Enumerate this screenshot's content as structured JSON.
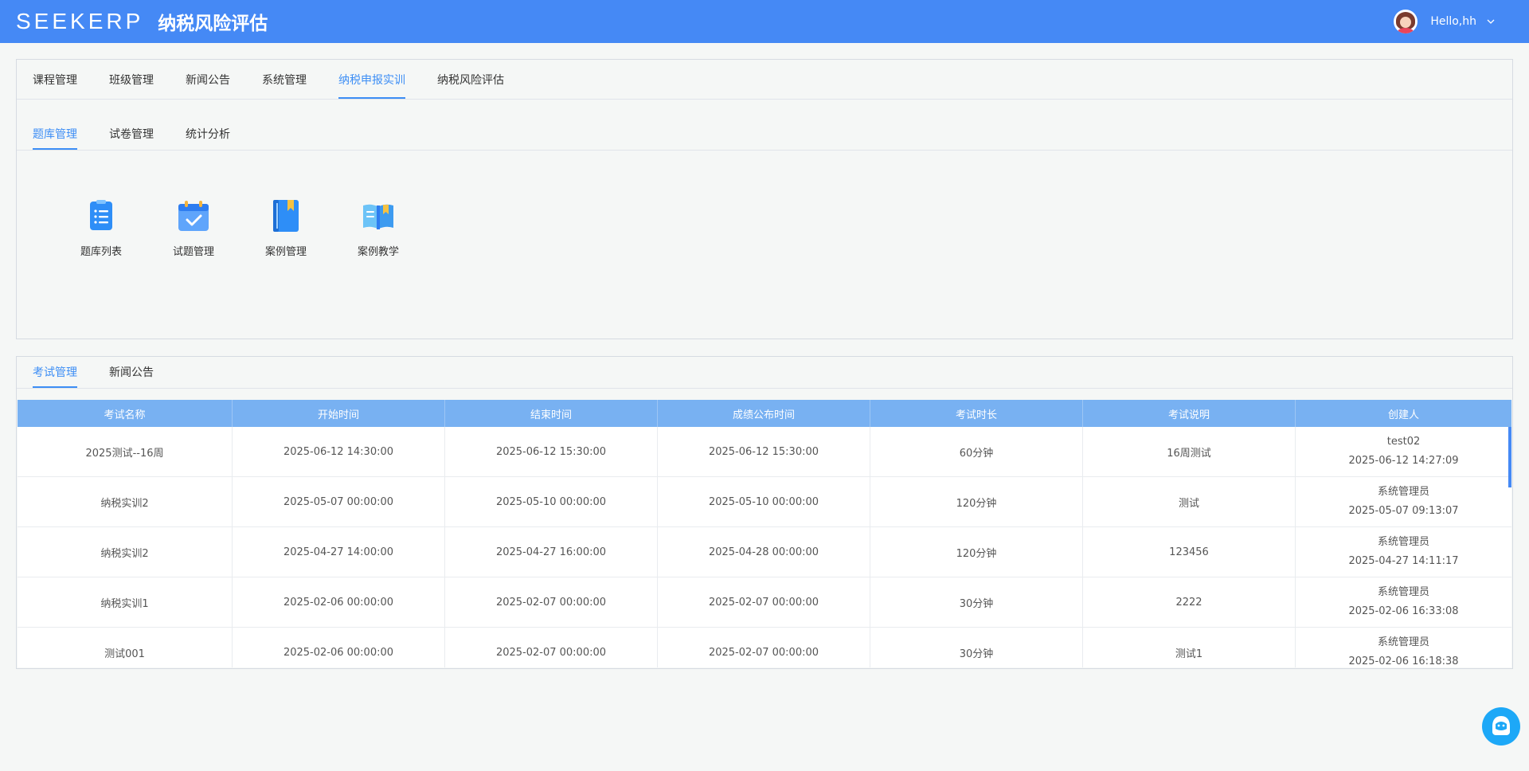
{
  "header": {
    "logo_text": "SEEKERP",
    "app_title": "纳税风险评估",
    "user_greeting": "Hello,hh"
  },
  "main_tabs": [
    {
      "label": "课程管理",
      "active": false
    },
    {
      "label": "班级管理",
      "active": false
    },
    {
      "label": "新闻公告",
      "active": false
    },
    {
      "label": "系统管理",
      "active": false
    },
    {
      "label": "纳税申报实训",
      "active": true
    },
    {
      "label": "纳税风险评估",
      "active": false
    }
  ],
  "sub_tabs": [
    {
      "label": "题库管理",
      "active": true
    },
    {
      "label": "试卷管理",
      "active": false
    },
    {
      "label": "统计分析",
      "active": false
    }
  ],
  "tiles": [
    {
      "label": "题库列表",
      "icon": "clipboard-list-icon"
    },
    {
      "label": "试题管理",
      "icon": "calendar-check-icon"
    },
    {
      "label": "案例管理",
      "icon": "bookmark-book-icon"
    },
    {
      "label": "案例教学",
      "icon": "open-book-icon"
    }
  ],
  "exam_tabs": [
    {
      "label": "考试管理",
      "active": true
    },
    {
      "label": "新闻公告",
      "active": false
    }
  ],
  "table": {
    "columns": [
      "考试名称",
      "开始时间",
      "结束时间",
      "成绩公布时间",
      "考试时长",
      "考试说明",
      "创建人"
    ],
    "rows": [
      {
        "name": "2025测试--16周",
        "start": "2025-06-12 14:30:00",
        "end": "2025-06-12 15:30:00",
        "publish": "2025-06-12 15:30:00",
        "duration": "60分钟",
        "desc": "16周测试",
        "creator": "test02",
        "created": "2025-06-12 14:27:09"
      },
      {
        "name": "纳税实训2",
        "start": "2025-05-07 00:00:00",
        "end": "2025-05-10 00:00:00",
        "publish": "2025-05-10 00:00:00",
        "duration": "120分钟",
        "desc": "测试",
        "creator": "系统管理员",
        "created": "2025-05-07 09:13:07"
      },
      {
        "name": "纳税实训2",
        "start": "2025-04-27 14:00:00",
        "end": "2025-04-27 16:00:00",
        "publish": "2025-04-28 00:00:00",
        "duration": "120分钟",
        "desc": "123456",
        "creator": "系统管理员",
        "created": "2025-04-27 14:11:17"
      },
      {
        "name": "纳税实训1",
        "start": "2025-02-06 00:00:00",
        "end": "2025-02-07 00:00:00",
        "publish": "2025-02-07 00:00:00",
        "duration": "30分钟",
        "desc": "2222",
        "creator": "系统管理员",
        "created": "2025-02-06 16:33:08"
      },
      {
        "name": "测试001",
        "start": "2025-02-06 00:00:00",
        "end": "2025-02-07 00:00:00",
        "publish": "2025-02-07 00:00:00",
        "duration": "30分钟",
        "desc": "测试1",
        "creator": "系统管理员",
        "created": "2025-02-06 16:18:38"
      }
    ]
  },
  "colors": {
    "header_bg": "#4589f5",
    "accent": "#3d8ef5",
    "table_header_bg": "#78b1f2"
  },
  "float_button": {
    "icon": "customer-service-icon"
  }
}
